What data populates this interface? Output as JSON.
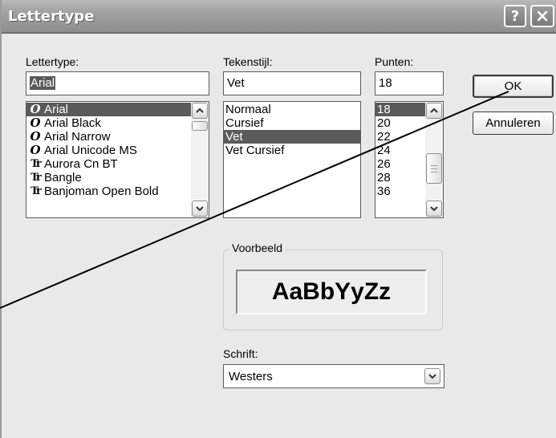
{
  "window": {
    "title": "Lettertype",
    "help_label": "?",
    "close_label": "✕"
  },
  "font": {
    "label": "Lettertype:",
    "input_value": "Aria",
    "input_cursor_char": "l",
    "items": [
      {
        "label": "Arial",
        "icon": "O-icon",
        "glyph": "O",
        "selected": true
      },
      {
        "label": "Arial Black",
        "icon": "O-icon",
        "glyph": "O",
        "selected": false
      },
      {
        "label": "Arial Narrow",
        "icon": "O-icon",
        "glyph": "O",
        "selected": false
      },
      {
        "label": "Arial Unicode MS",
        "icon": "O-icon",
        "glyph": "O",
        "selected": false
      },
      {
        "label": "Aurora Cn BT",
        "icon": "truetype-icon",
        "glyph": "Tr",
        "selected": false
      },
      {
        "label": "Bangle",
        "icon": "truetype-icon",
        "glyph": "Tr",
        "selected": false
      },
      {
        "label": "Banjoman Open Bold",
        "icon": "truetype-icon",
        "glyph": "Tr",
        "selected": false
      }
    ]
  },
  "style": {
    "label": "Tekenstijl:",
    "input_value": "Vet",
    "items": [
      {
        "label": "Normaal",
        "selected": false
      },
      {
        "label": "Cursief",
        "selected": false
      },
      {
        "label": "Vet",
        "selected": true
      },
      {
        "label": "Vet Cursief",
        "selected": false
      }
    ]
  },
  "size": {
    "label": "Punten:",
    "input_value": "18",
    "items": [
      {
        "label": "18",
        "selected": true
      },
      {
        "label": "20",
        "selected": false
      },
      {
        "label": "22",
        "selected": false
      },
      {
        "label": "24",
        "selected": false
      },
      {
        "label": "26",
        "selected": false
      },
      {
        "label": "28",
        "selected": false
      },
      {
        "label": "36",
        "selected": false
      }
    ]
  },
  "buttons": {
    "ok": "OK",
    "cancel": "Annuleren"
  },
  "preview": {
    "label": "Voorbeeld",
    "sample_text": "AaBbYyZz"
  },
  "script": {
    "label": "Schrift:",
    "value": "Westers"
  }
}
